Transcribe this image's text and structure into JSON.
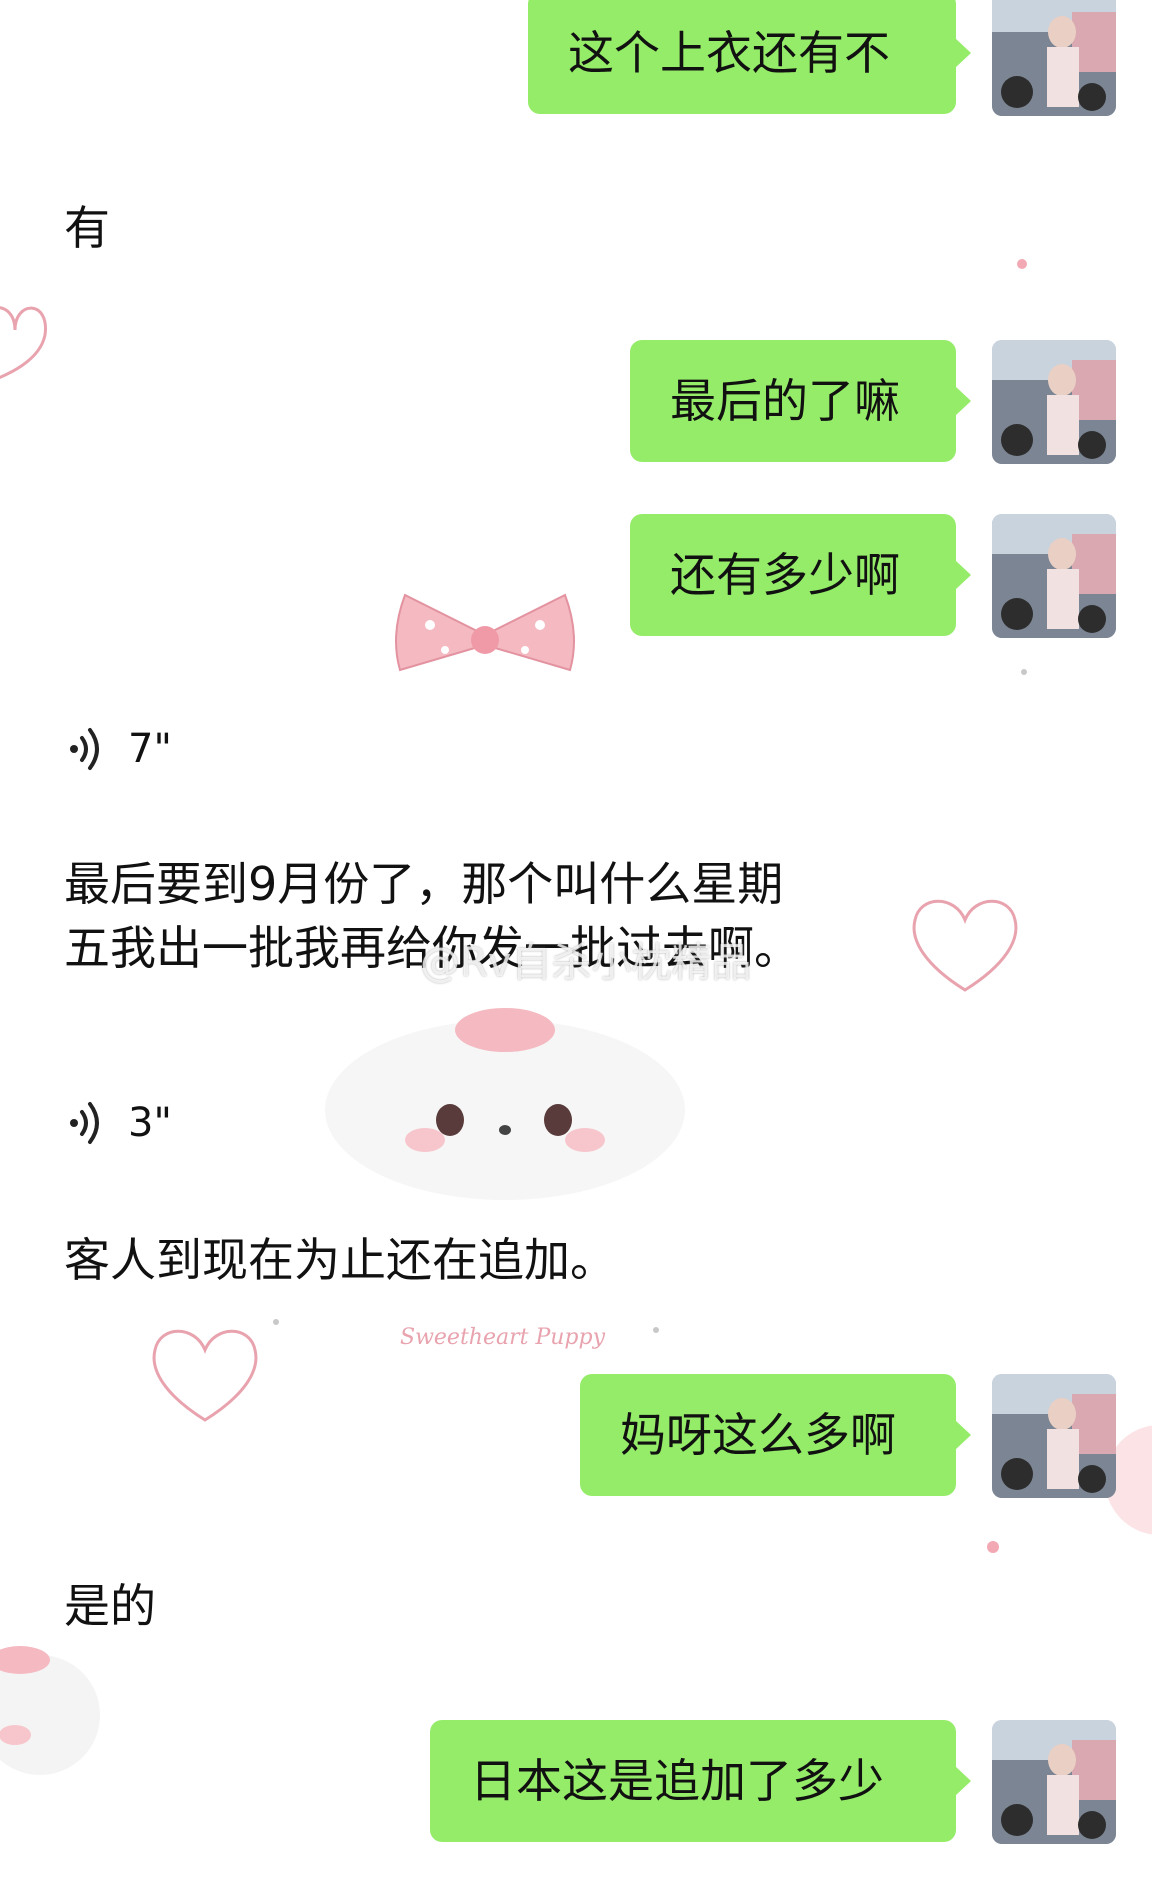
{
  "messages": [
    {
      "type": "sent",
      "text": "这个上衣还有不"
    },
    {
      "type": "received",
      "text": "有"
    },
    {
      "type": "sent",
      "text": "最后的了嘛"
    },
    {
      "type": "sent",
      "text": "还有多少啊"
    },
    {
      "type": "voice",
      "duration": "7\""
    },
    {
      "type": "received",
      "lines": [
        "最后要到9月份了，那个叫什么星期",
        "五我出一批我再给你发一批过去啊。"
      ]
    },
    {
      "type": "voice",
      "duration": "3\""
    },
    {
      "type": "received",
      "text": "客人到现在为止还在追加。"
    },
    {
      "type": "sent",
      "text": "妈呀这么多啊"
    },
    {
      "type": "received",
      "text": "是的"
    },
    {
      "type": "sent",
      "text": "日本这是追加了多少"
    }
  ],
  "background": {
    "deco_text_1": "Sweetheart Puppy",
    "watermark": "@Rv自杀小枕精品"
  },
  "colors": {
    "sent_bubble": "#95ec69",
    "deco_pink": "#e8a3ae",
    "text": "#111111"
  },
  "icons": {
    "voice": "voice-wave-icon",
    "avatar": "user-avatar"
  }
}
